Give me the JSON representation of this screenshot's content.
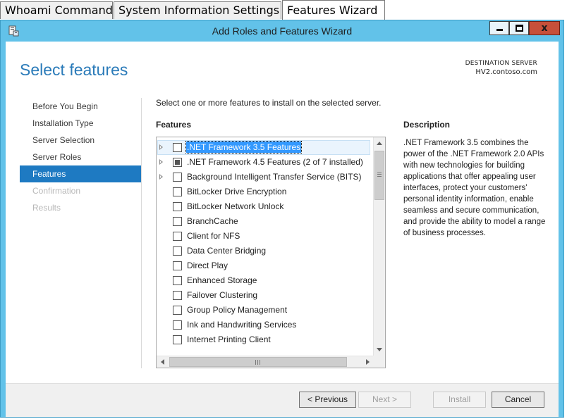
{
  "tabs": [
    {
      "label": "Whoami Command"
    },
    {
      "label": "System Information Settings"
    },
    {
      "label": "Features Wizard"
    }
  ],
  "window": {
    "title": "Add Roles and Features Wizard",
    "close_glyph": "x"
  },
  "page": {
    "title": "Select features",
    "destination_label": "DESTINATION SERVER",
    "destination_server": "HV2.contoso.com",
    "instruction": "Select one or more features to install on the selected server."
  },
  "nav": {
    "items": [
      {
        "label": "Before You Begin",
        "state": "normal"
      },
      {
        "label": "Installation Type",
        "state": "normal"
      },
      {
        "label": "Server Selection",
        "state": "normal"
      },
      {
        "label": "Server Roles",
        "state": "normal"
      },
      {
        "label": "Features",
        "state": "active"
      },
      {
        "label": "Confirmation",
        "state": "disabled"
      },
      {
        "label": "Results",
        "state": "disabled"
      }
    ]
  },
  "features": {
    "heading": "Features",
    "items": [
      {
        "label": ".NET Framework 3.5 Features",
        "expandable": true,
        "checked": "none",
        "selected": true
      },
      {
        "label": ".NET Framework 4.5 Features (2 of 7 installed)",
        "expandable": true,
        "checked": "partial",
        "selected": false
      },
      {
        "label": "Background Intelligent Transfer Service (BITS)",
        "expandable": true,
        "checked": "none",
        "selected": false
      },
      {
        "label": "BitLocker Drive Encryption",
        "expandable": false,
        "checked": "none",
        "selected": false
      },
      {
        "label": "BitLocker Network Unlock",
        "expandable": false,
        "checked": "none",
        "selected": false
      },
      {
        "label": "BranchCache",
        "expandable": false,
        "checked": "none",
        "selected": false
      },
      {
        "label": "Client for NFS",
        "expandable": false,
        "checked": "none",
        "selected": false
      },
      {
        "label": "Data Center Bridging",
        "expandable": false,
        "checked": "none",
        "selected": false
      },
      {
        "label": "Direct Play",
        "expandable": false,
        "checked": "none",
        "selected": false
      },
      {
        "label": "Enhanced Storage",
        "expandable": false,
        "checked": "none",
        "selected": false
      },
      {
        "label": "Failover Clustering",
        "expandable": false,
        "checked": "none",
        "selected": false
      },
      {
        "label": "Group Policy Management",
        "expandable": false,
        "checked": "none",
        "selected": false
      },
      {
        "label": "Ink and Handwriting Services",
        "expandable": false,
        "checked": "none",
        "selected": false
      },
      {
        "label": "Internet Printing Client",
        "expandable": false,
        "checked": "none",
        "selected": false
      }
    ]
  },
  "description": {
    "heading": "Description",
    "text": ".NET Framework 3.5 combines the power of the .NET Framework 2.0 APIs with new technologies for building applications that offer appealing user interfaces, protect your customers' personal identity information, enable seamless and secure communication, and provide the ability to model a range of business processes."
  },
  "buttons": {
    "previous": "< Previous",
    "next": "Next >",
    "install": "Install",
    "cancel": "Cancel"
  },
  "colors": {
    "window_frame": "#62c2e9",
    "accent": "#1e7ac2",
    "title_text": "#2b7bb9",
    "selection": "#3399ff",
    "close_button": "#c7503a"
  },
  "icons": {
    "app": "server-manager-icon",
    "minimize": "minimize-icon",
    "maximize": "maximize-icon",
    "close": "close-icon",
    "expand": "triangle-right-icon",
    "scroll_up": "arrow-up-icon",
    "scroll_down": "arrow-down-icon",
    "scroll_left": "arrow-left-icon",
    "scroll_right": "arrow-right-icon"
  }
}
